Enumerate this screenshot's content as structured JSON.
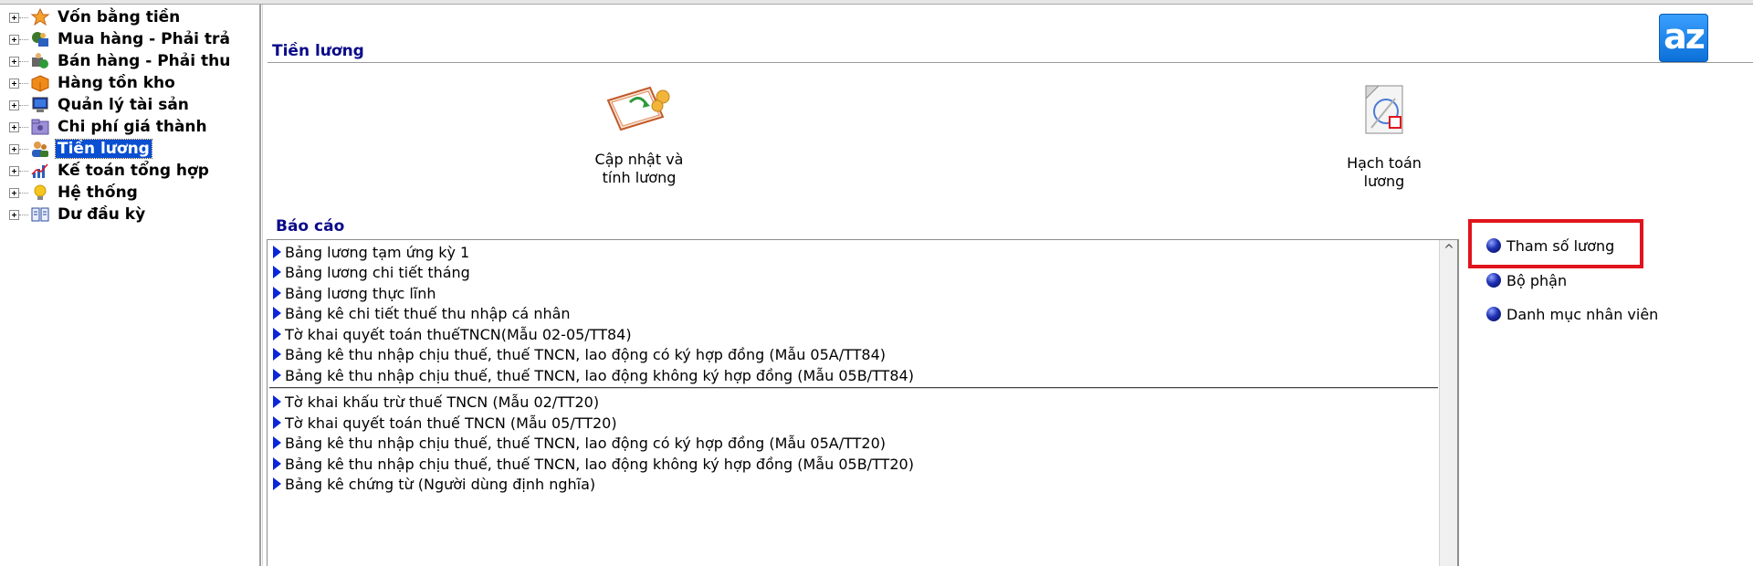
{
  "tree": {
    "items": [
      {
        "label": "Vốn bằng tiền",
        "icon": "medal-icon"
      },
      {
        "label": "Mua hàng - Phải trả",
        "icon": "purchase-icon"
      },
      {
        "label": "Bán hàng - Phải thu",
        "icon": "sales-icon"
      },
      {
        "label": "Hàng tồn kho",
        "icon": "inventory-box-icon"
      },
      {
        "label": "Quản lý tài sản",
        "icon": "computer-icon"
      },
      {
        "label": "Chi phí giá thành",
        "icon": "folder-icon"
      },
      {
        "label": "Tiền lương",
        "icon": "people-icon",
        "selected": true
      },
      {
        "label": "Kế toán tổng hợp",
        "icon": "chart-icon"
      },
      {
        "label": "Hệ thống",
        "icon": "lightbulb-icon"
      },
      {
        "label": "Dư đầu kỳ",
        "icon": "book-icon"
      }
    ]
  },
  "main": {
    "section_title": "Tiền lương",
    "logo_text": "az",
    "tiles": [
      {
        "line1": "Cập nhật và",
        "line2": "tính lương",
        "icon": "salary-update-icon"
      },
      {
        "line1": "Hạch toán",
        "line2": "lương",
        "icon": "salary-accounting-icon"
      }
    ],
    "reports_title": "Báo cáo",
    "reports_group1": [
      "Bảng lương tạm ứng kỳ 1",
      "Bảng lương chi tiết tháng",
      "Bảng lương thực lĩnh",
      "Bảng kê chi tiết thuế thu nhập cá nhân",
      "Tờ khai quyết toán thuếTNCN(Mẫu 02-05/TT84)",
      "Bảng kê thu nhập chịu thuế, thuế TNCN, lao động có ký hợp đồng (Mẫu 05A/TT84)",
      "Bảng kê thu nhập chịu thuế, thuế TNCN, lao động không ký hợp đồng (Mẫu 05B/TT84)"
    ],
    "reports_group2": [
      "Tờ khai khấu trừ thuế TNCN (Mẫu 02/TT20)",
      "Tờ khai quyết toán thuế TNCN (Mẫu 05/TT20)",
      "Bảng kê thu nhập chịu thuế, thuế TNCN, lao động có ký hợp đồng (Mẫu 05A/TT20)",
      "Bảng kê thu nhập chịu thuế, thuế TNCN, lao động không ký hợp đồng (Mẫu 05B/TT20)",
      "Bảng kê chứng từ (Người dùng định nghĩa)"
    ],
    "side_links": [
      {
        "label": "Tham số lương",
        "highlighted": true
      },
      {
        "label": "Bộ phận"
      },
      {
        "label": "Danh mục nhân viên"
      }
    ],
    "colors": {
      "section_title": "#0a0a8a",
      "selection": "#0a4fd1",
      "arrow": "#0b26d9",
      "highlight_border": "#e0141c"
    }
  }
}
